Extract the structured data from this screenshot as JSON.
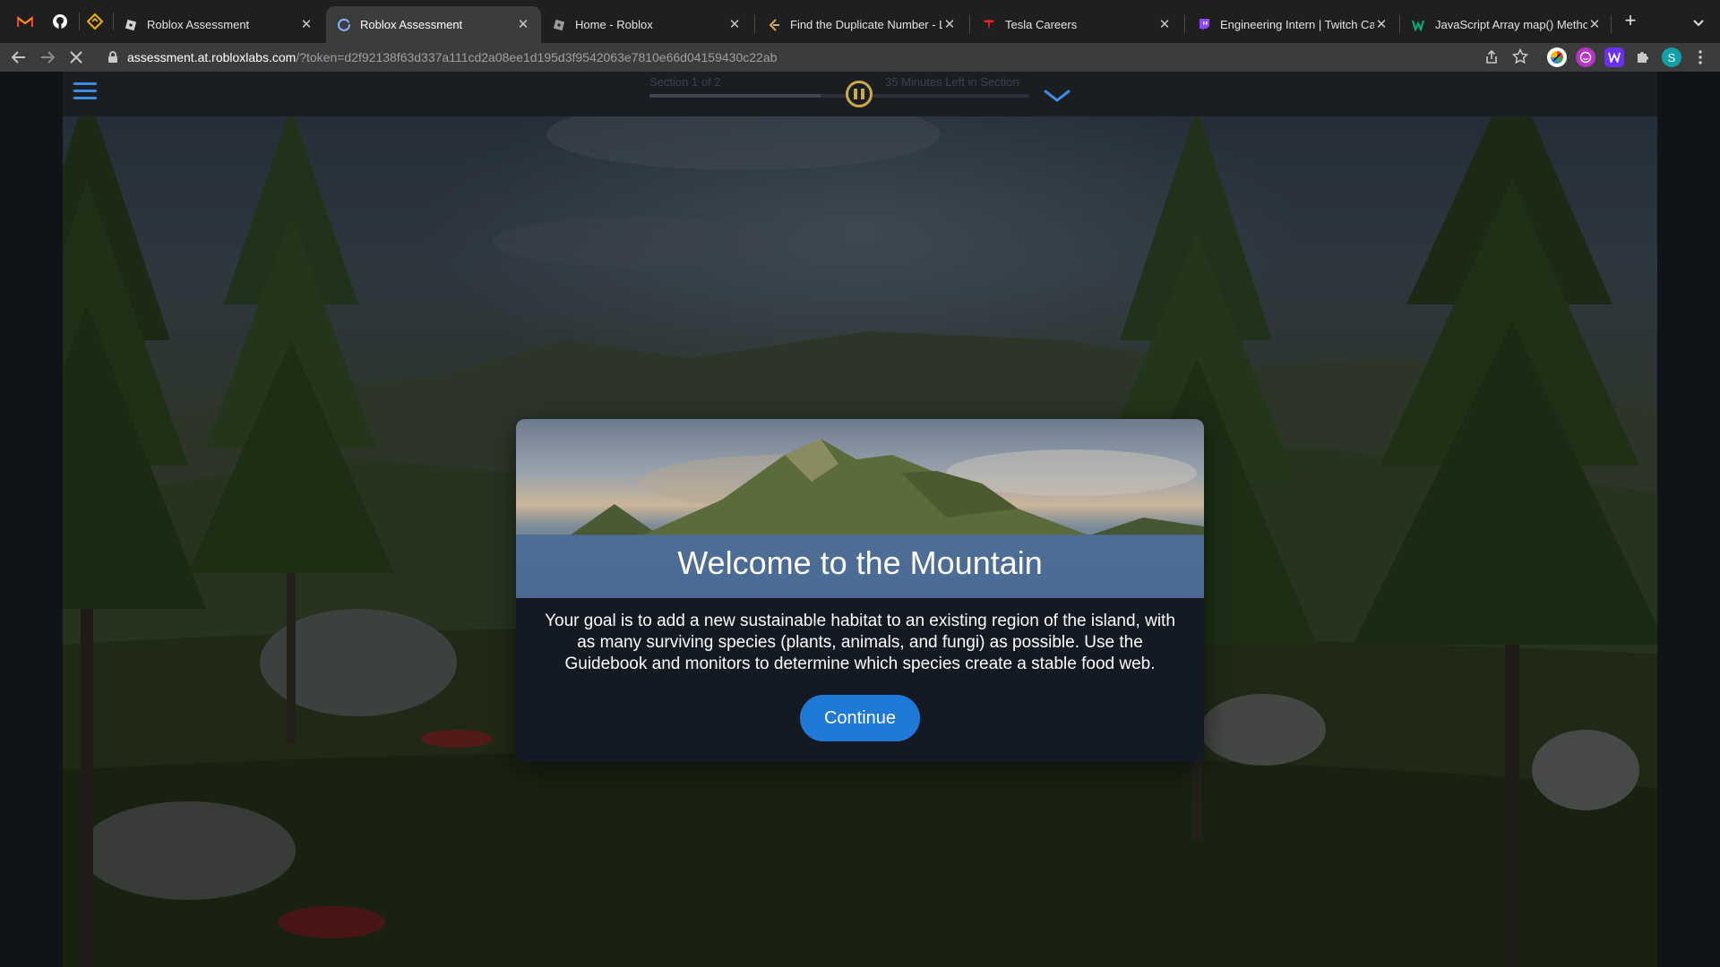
{
  "browser": {
    "tabs": [
      {
        "title": "Roblox Assessment",
        "active": false,
        "favicon": "roblox-icon"
      },
      {
        "title": "Roblox Assessment",
        "active": true,
        "favicon": "loading-spinner-icon"
      },
      {
        "title": "Home - Roblox",
        "active": false,
        "favicon": "roblox-icon"
      },
      {
        "title": "Find the Duplicate Number - Le",
        "active": false,
        "favicon": "leetcode-icon"
      },
      {
        "title": "Tesla Careers",
        "active": false,
        "favicon": "tesla-icon"
      },
      {
        "title": "Engineering Intern | Twitch Car",
        "active": false,
        "favicon": "twitch-icon"
      },
      {
        "title": "JavaScript Array map() Metho",
        "active": false,
        "favicon": "w3schools-icon"
      }
    ],
    "close_glyph": "✕",
    "new_tab_glyph": "+",
    "url_domain": "assessment.at.robloxlabs.com",
    "url_rest": "/?token=d2f92138f63d337a111cd2a08ee1d195d3f9542063e7810e66d04159430c22ab",
    "profile_initial": "S",
    "colors": {
      "tab_strip": "#1f1f1f",
      "toolbar": "#3c3c3c",
      "profile": "#11a1a8"
    }
  },
  "hud": {
    "section_label": "Section 1 of 2",
    "time_label": "35 Minutes Left in Section",
    "progress_fraction": 0.45,
    "accent": "#c9a94a"
  },
  "modal": {
    "title": "Welcome to the Mountain",
    "body": "Your goal is to add a new sustainable habitat to an existing region of the island, with as many surviving species (plants, animals, and fungi) as possible. Use the Guidebook and monitors to determine which species create a stable food web.",
    "button_label": "Continue",
    "button_color": "#1f7ad7"
  }
}
